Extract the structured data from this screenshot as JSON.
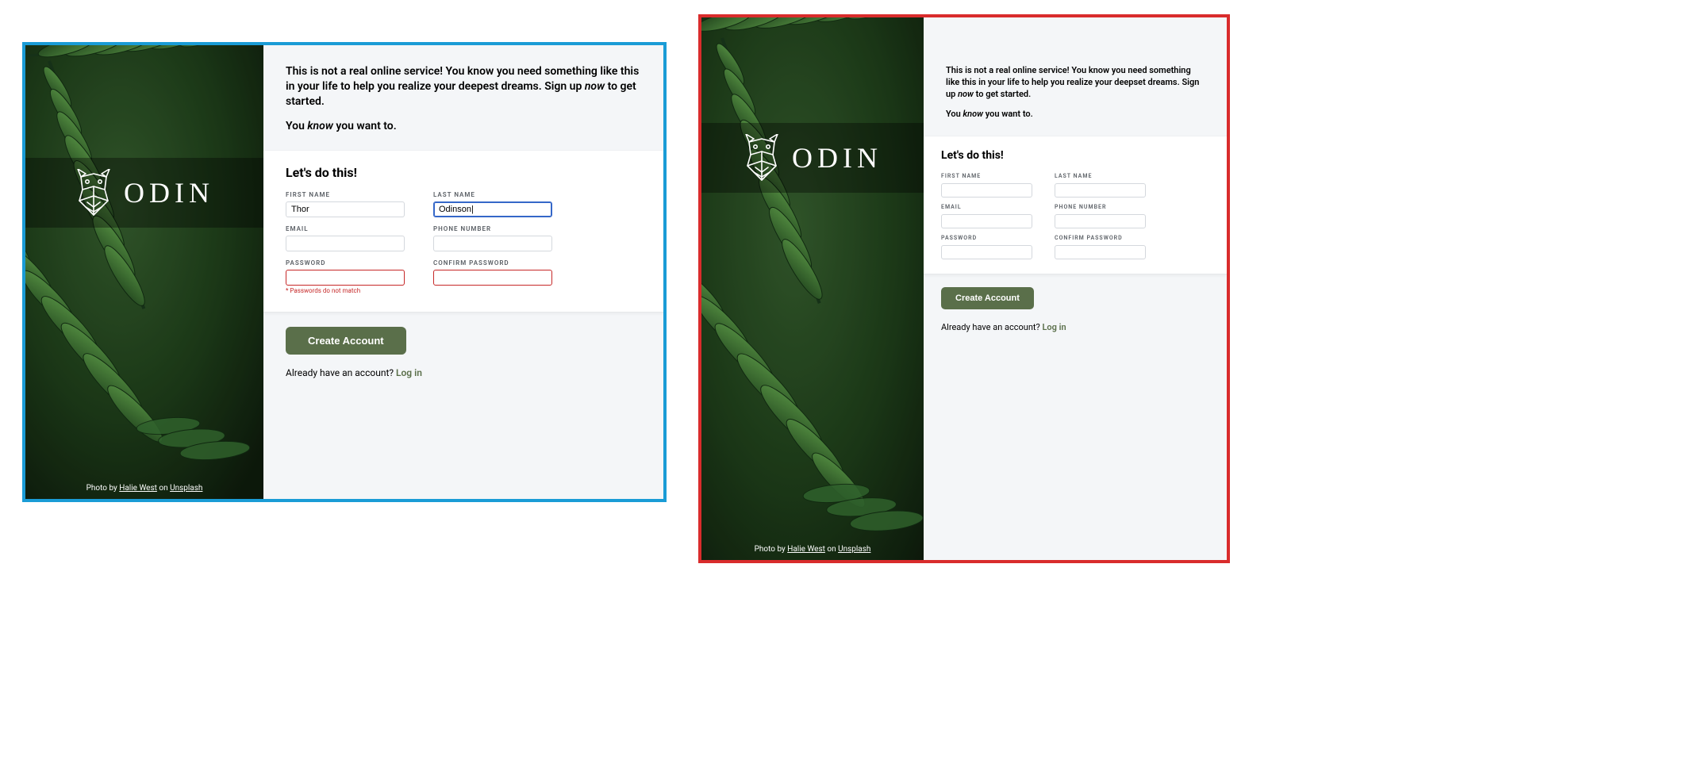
{
  "brand": {
    "name": "ODIN"
  },
  "credit": {
    "prefix": "Photo by ",
    "author": "Halie West",
    "mid": " on ",
    "site": "Unsplash"
  },
  "intro": {
    "line1_prefix": "This is not a real online service! You know you need something like this in your life to help you realize your deepest dreams. Sign up ",
    "line1_em": "now",
    "line1_suffix": " to get started.",
    "line2_prefix": "You ",
    "line2_em": "know",
    "line2_suffix": " you want to."
  },
  "form": {
    "heading": "Let's do this!",
    "labels": {
      "first_name": "FIRST NAME",
      "last_name": "LAST NAME",
      "email": "EMAIL",
      "phone": "PHONE NUMBER",
      "password": "PASSWORD",
      "confirm": "CONFIRM PASSWORD"
    },
    "values": {
      "first_name": "Thor",
      "last_name": "Odinson|"
    },
    "errors": {
      "password_mismatch": "* Passwords do not match"
    },
    "submit": "Create Account",
    "login_prompt": "Already have an account? ",
    "login_link": "Log in"
  },
  "variant_right": {
    "intro_line1": "This is not a real online service! You know you need something like this in your life to help you realize your deepset dreams. Sign up "
  }
}
